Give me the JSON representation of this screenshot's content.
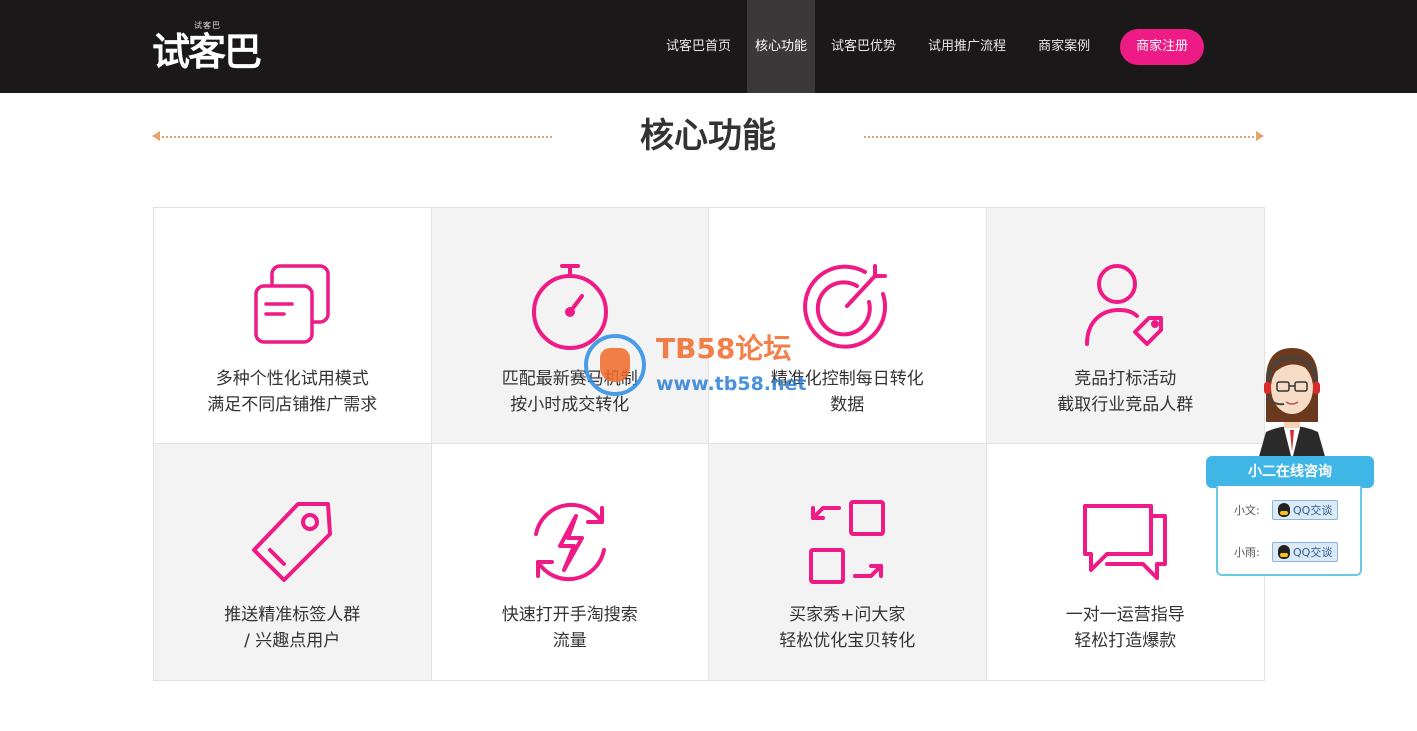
{
  "header": {
    "logo_small": "试客巴",
    "logo": "试客巴",
    "nav": [
      {
        "label": "试客巴首页"
      },
      {
        "label": "核心功能"
      },
      {
        "label": "试客巴优势"
      },
      {
        "label": "试用推广流程"
      },
      {
        "label": "商家案例"
      }
    ],
    "register": "商家注册"
  },
  "section": {
    "title": "核心功能"
  },
  "features": [
    {
      "icon": "documents-icon",
      "line1": "多种个性化试用模式",
      "line2": "满足不同店铺推广需求"
    },
    {
      "icon": "stopwatch-icon",
      "line1": "匹配最新赛马机制",
      "line2": "按小时成交转化"
    },
    {
      "icon": "target-icon",
      "line1": "精准化控制每日转化",
      "line2": "数据"
    },
    {
      "icon": "user-tag-icon",
      "line1": "竞品打标活动",
      "line2": "截取行业竞品人群"
    },
    {
      "icon": "price-tag-icon",
      "line1": "推送精准标签人群",
      "line2": "/ 兴趣点用户"
    },
    {
      "icon": "lightning-refresh-icon",
      "line1": "快速打开手淘搜索",
      "line2": "流量"
    },
    {
      "icon": "exchange-squares-icon",
      "line1": "买家秀+问大家",
      "line2": "轻松优化宝贝转化"
    },
    {
      "icon": "chat-bubbles-icon",
      "line1": "一对一运营指导",
      "line2": "轻松打造爆款"
    }
  ],
  "watermark": {
    "title": "TB58论坛",
    "url": "www.tb58.net"
  },
  "support": {
    "title": "小二在线咨询",
    "agents": [
      {
        "name": "小文:",
        "button": "QQ交谈"
      },
      {
        "name": "小雨:",
        "button": "QQ交谈"
      }
    ]
  },
  "colors": {
    "accent": "#ee1a85",
    "header_bg": "#1a1818",
    "title_line": "#e2a56c"
  }
}
